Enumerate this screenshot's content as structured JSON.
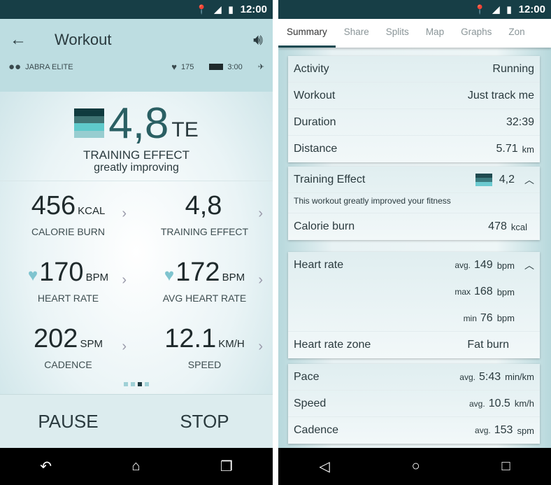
{
  "status": {
    "time": "12:00"
  },
  "left": {
    "title": "Workout",
    "device": "JABRA ELITE",
    "hr": "175",
    "timer": "3:00",
    "te": {
      "value": "4,8",
      "unit": "TE",
      "label": "TRAINING EFFECT",
      "sub": "greatly improving",
      "colors": [
        "#0f3a3e",
        "#3f7474",
        "#5fcacb",
        "#97cdd0"
      ]
    },
    "metrics": [
      {
        "value": "456",
        "unit": "KCAL",
        "label": "CALORIE BURN",
        "heart": false
      },
      {
        "value": "4,8",
        "unit": "",
        "label": "TRAINING EFFECT",
        "heart": false
      },
      {
        "value": "170",
        "unit": "BPM",
        "label": "HEART RATE",
        "heart": true
      },
      {
        "value": "172",
        "unit": "BPM",
        "label": "AVG HEART RATE",
        "heart": true
      },
      {
        "value": "202",
        "unit": "SPM",
        "label": "CADENCE",
        "heart": false
      },
      {
        "value": "12.1",
        "unit": "KM/H",
        "label": "SPEED",
        "heart": false
      }
    ],
    "page_indicator": {
      "pages": 4,
      "current": 3
    },
    "pause": "PAUSE",
    "stop": "STOP"
  },
  "right": {
    "tabs": [
      "Summary",
      "Share",
      "Splits",
      "Map",
      "Graphs",
      "Zon"
    ],
    "active_tab": "Summary",
    "basics": [
      {
        "k": "Activity",
        "v": "Running",
        "u": ""
      },
      {
        "k": "Workout",
        "v": "Just track me",
        "u": ""
      },
      {
        "k": "Duration",
        "v": "32:39",
        "u": ""
      },
      {
        "k": "Distance",
        "v": "5.71",
        "u": "km"
      }
    ],
    "te": {
      "k": "Training Effect",
      "v": "4,2",
      "note": "This workout greatly improved your fitness",
      "cal_k": "Calorie burn",
      "cal_v": "478",
      "cal_u": "kcal"
    },
    "hr": {
      "k": "Heart rate",
      "avg_l": "avg.",
      "avg": "149",
      "max_l": "max",
      "max": "168",
      "min_l": "min",
      "min": "76",
      "u": "bpm",
      "zone_k": "Heart rate zone",
      "zone_v": "Fat burn"
    },
    "pace": [
      {
        "k": "Pace",
        "l": "avg.",
        "v": "5:43",
        "u": "min/km"
      },
      {
        "k": "Speed",
        "l": "avg.",
        "v": "10.5",
        "u": "km/h"
      },
      {
        "k": "Cadence",
        "l": "avg.",
        "v": "153",
        "u": "spm"
      }
    ]
  }
}
